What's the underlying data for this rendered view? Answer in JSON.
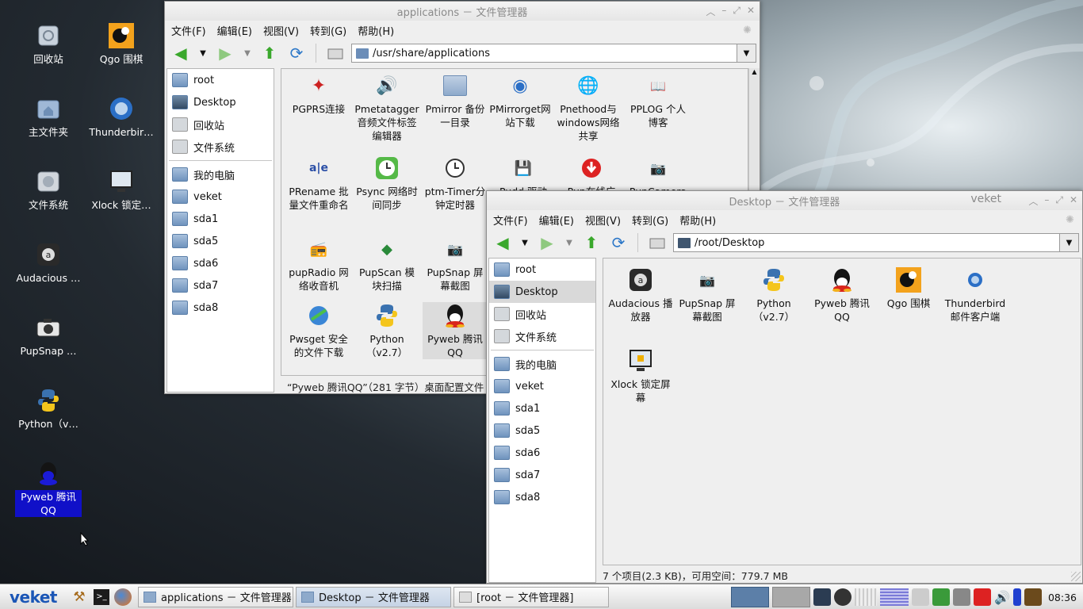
{
  "desktop_icons": [
    {
      "label": "回收站",
      "icon": "trash-icon"
    },
    {
      "label": "Qgo 围棋",
      "icon": "go-game-icon"
    },
    {
      "label": "主文件夹",
      "icon": "home-folder-icon"
    },
    {
      "label": "Thunderbir…",
      "icon": "thunderbird-icon"
    },
    {
      "label": "文件系统",
      "icon": "harddisk-icon"
    },
    {
      "label": "Xlock 锁定…",
      "icon": "xlock-icon"
    },
    {
      "label": "Audacious …",
      "icon": "audacious-icon"
    },
    {
      "label": "PupSnap …",
      "icon": "camera-icon"
    },
    {
      "label": "Python（v…",
      "icon": "python-icon"
    },
    {
      "label": "Pyweb 腾讯QQ",
      "icon": "qq-icon"
    }
  ],
  "win1": {
    "title": "applications － 文件管理器",
    "menu": [
      "文件(F)",
      "编辑(E)",
      "视图(V)",
      "转到(G)",
      "帮助(H)"
    ],
    "path": "/usr/share/applications",
    "sidebar": [
      "root",
      "Desktop",
      "回收站",
      "文件系统",
      "我的电脑",
      "veket",
      "sda1",
      "sda5",
      "sda6",
      "sda7",
      "sda8"
    ],
    "files": [
      "PGPRS连接",
      "Pmetatagger音频文件标签编辑器",
      "Pmirror 备份一目录",
      "PMirrorget网站下载",
      "Pnethood与windows网络共享",
      "PPLOG 个人博客",
      "PRename 批量文件重命名",
      "Psync 网络时间同步",
      "ptm-Timer分钟定时器",
      "Pudd 驱动",
      "Pup在线广",
      "PupCamera",
      "pupRadio 网络收音机",
      "PupScan 模块扫描",
      "PupSnap 屏幕截图",
      "Pwsget 安全的文件下载",
      "Python（v2.7）",
      "Pyweb 腾讯QQ"
    ],
    "status": "“Pyweb 腾讯QQ”（281 字节）桌面配置文件"
  },
  "win2": {
    "title": "Desktop － 文件管理器",
    "host": "veket",
    "menu": [
      "文件(F)",
      "编辑(E)",
      "视图(V)",
      "转到(G)",
      "帮助(H)"
    ],
    "path": "/root/Desktop",
    "sidebar": [
      "root",
      "Desktop",
      "回收站",
      "文件系统",
      "我的电脑",
      "veket",
      "sda1",
      "sda5",
      "sda6",
      "sda7",
      "sda8"
    ],
    "files": [
      "Audacious 播放器",
      "PupSnap 屏幕截图",
      "Python（v2.7）",
      "Pyweb 腾讯QQ",
      "Qgo 围棋",
      "Thunderbird 邮件客户端",
      "Xlock 锁定屏幕"
    ],
    "status": "7 个项目(2.3 KB)，可用空间：779.7 MB"
  },
  "taskbar": {
    "logo": "veket",
    "tasks": [
      "applications － 文件管理器",
      "Desktop － 文件管理器",
      "[root － 文件管理器]"
    ],
    "clock": "08:36"
  }
}
